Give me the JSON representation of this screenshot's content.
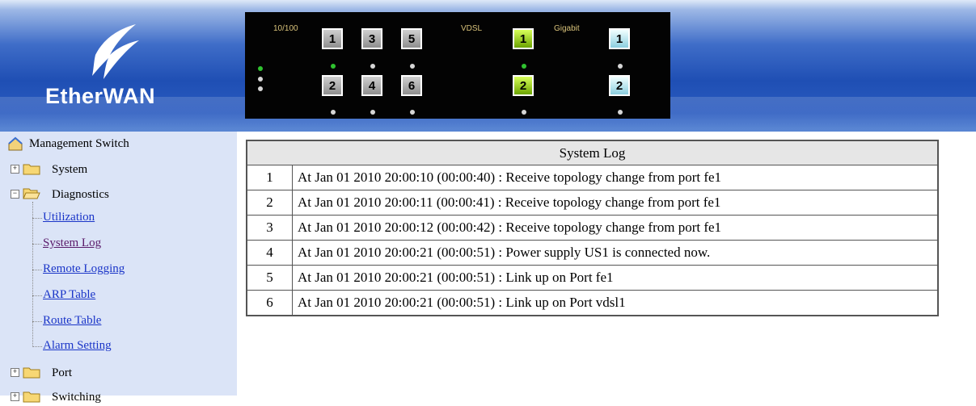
{
  "brand": {
    "logo_left": "Ether",
    "logo_right": "WAN"
  },
  "panel": {
    "group_fe": "10/100",
    "group_vdsl": "VDSL",
    "group_gigabit": "Gigabit",
    "fe_ports": [
      "1",
      "3",
      "5",
      "2",
      "4",
      "6"
    ],
    "vdsl_ports": [
      "1",
      "2"
    ],
    "gigabit_ports": [
      "1",
      "2"
    ]
  },
  "sidebar": {
    "root": "Management Switch",
    "system": "System",
    "diagnostics": "Diagnostics",
    "diag_items": [
      "Utilization",
      "System Log",
      "Remote Logging",
      "ARP Table",
      "Route Table",
      "Alarm Setting"
    ],
    "port": "Port",
    "switching": "Switching"
  },
  "log": {
    "title": "System Log",
    "rows": [
      {
        "index": "1",
        "message": "At Jan 01 2010 20:00:10 (00:00:40) : Receive topology change from port fe1"
      },
      {
        "index": "2",
        "message": "At Jan 01 2010 20:00:11 (00:00:41) : Receive topology change from port fe1"
      },
      {
        "index": "3",
        "message": "At Jan 01 2010 20:00:12 (00:00:42) : Receive topology change from port fe1"
      },
      {
        "index": "4",
        "message": "At Jan 01 2010 20:00:21 (00:00:51) : Power supply US1 is connected now."
      },
      {
        "index": "5",
        "message": "At Jan 01 2010 20:00:21 (00:00:51) : Link up on Port fe1"
      },
      {
        "index": "6",
        "message": "At Jan 01 2010 20:00:21 (00:00:51) : Link up on Port vdsl1"
      }
    ]
  },
  "colors": {
    "led_on": "#2fc22f",
    "vdsl_port": "#9bd400",
    "gigabit_port": "#bfe8f0",
    "sidebar_bg": "#dbe4f7"
  }
}
